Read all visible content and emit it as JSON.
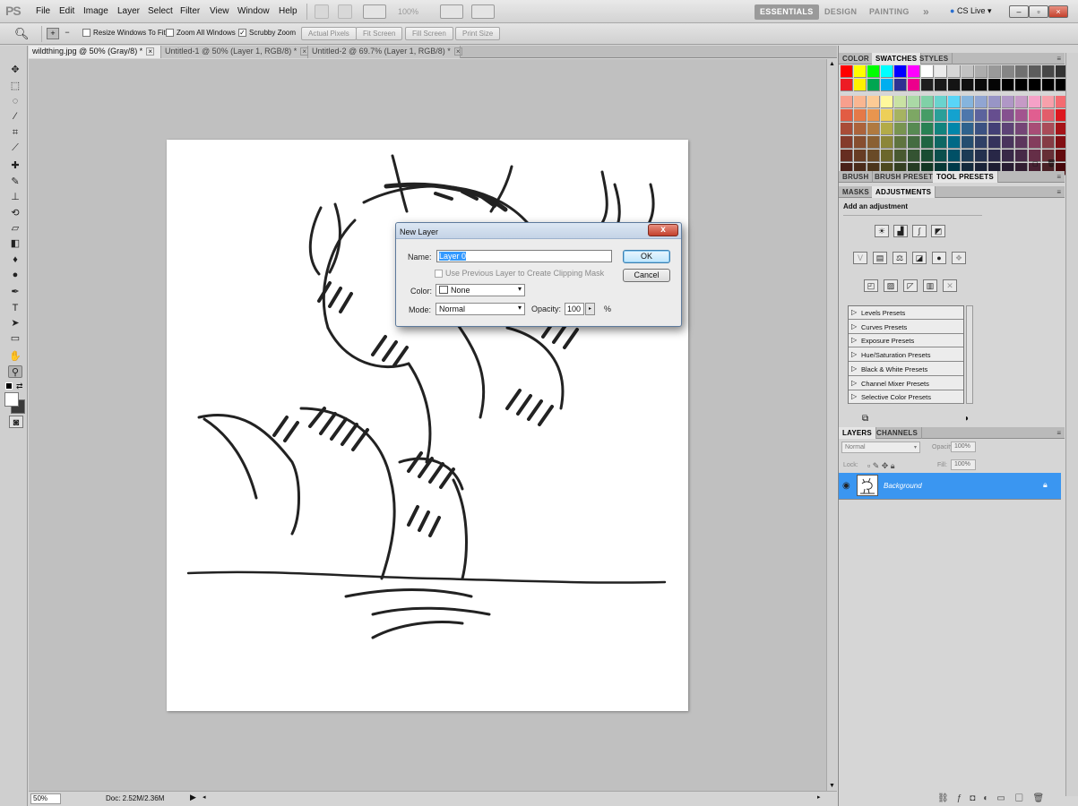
{
  "app": {
    "logo": "PS"
  },
  "menu": [
    "File",
    "Edit",
    "Image",
    "Layer",
    "Select",
    "Filter",
    "View",
    "Window",
    "Help"
  ],
  "menubar": {
    "zoom": "100%"
  },
  "workspaces": {
    "essentials": "ESSENTIALS",
    "design": "DESIGN",
    "painting": "PAINTING",
    "more": "»",
    "cslive": "CS Live"
  },
  "options": {
    "resize_windows": "Resize Windows To Fit",
    "zoom_all": "Zoom All Windows",
    "scrubby_zoom": "Scrubby Zoom",
    "actual_pixels": "Actual Pixels",
    "fit_screen": "Fit Screen",
    "fill_screen": "Fill Screen",
    "print_size": "Print Size"
  },
  "tabs": [
    {
      "label": "wildthing.jpg @ 50% (Gray/8) *"
    },
    {
      "label": "Untitled-1 @ 50% (Layer 1, RGB/8) *"
    },
    {
      "label": "Untitled-2 @ 69.7% (Layer 1, RGB/8) *"
    }
  ],
  "status": {
    "zoom": "50%",
    "doc": "Doc: 2.52M/2.36M"
  },
  "panels": {
    "color_tabs": [
      "COLOR",
      "SWATCHES",
      "STYLES"
    ],
    "brush_tabs": [
      "BRUSH",
      "BRUSH PRESETS",
      "TOOL PRESETS"
    ],
    "adjust_tabs": [
      "MASKS",
      "ADJUSTMENTS"
    ],
    "add_adjustment": "Add an adjustment",
    "presets": [
      "Levels Presets",
      "Curves Presets",
      "Exposure Presets",
      "Hue/Saturation Presets",
      "Black & White Presets",
      "Channel Mixer Presets",
      "Selective Color Presets"
    ],
    "layers_tabs": [
      "LAYERS",
      "CHANNELS"
    ],
    "layers": {
      "mode": "Normal",
      "opacity_label": "Opacity:",
      "opacity": "100%",
      "lock_label": "Lock:",
      "fill_label": "Fill:",
      "fill": "100%",
      "layer_name": "Background"
    }
  },
  "dialog": {
    "title": "New Layer",
    "close": "x",
    "name_label": "Name:",
    "name_value": "Layer 0",
    "clip_label": "Use Previous Layer to Create Clipping Mask",
    "color_label": "Color:",
    "color_value": "None",
    "mode_label": "Mode:",
    "mode_value": "Normal",
    "opacity_label": "Opacity:",
    "opacity_value": "100",
    "opacity_unit": "%",
    "ok": "OK",
    "cancel": "Cancel"
  },
  "colors": {
    "accent": "#3a96f1",
    "close": "#c3412d"
  }
}
